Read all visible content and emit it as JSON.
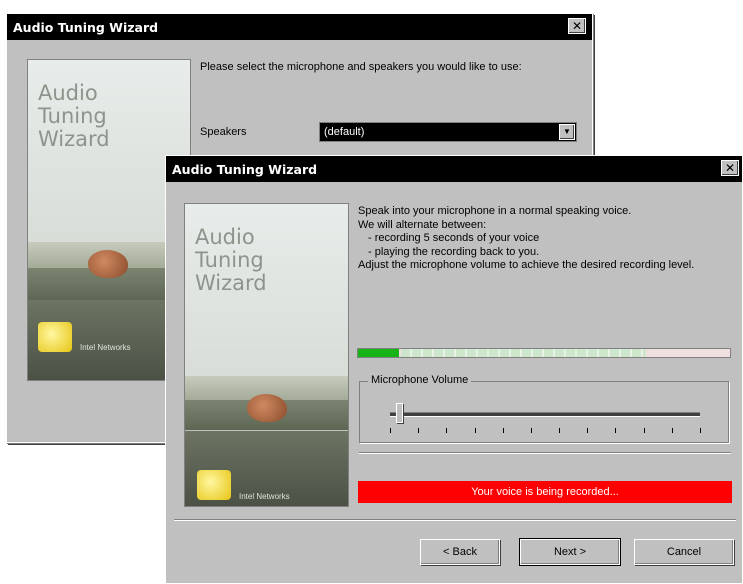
{
  "back_window": {
    "title": "Audio Tuning Wizard",
    "close_glyph": "✕",
    "instructions": "Please select the microphone and speakers you would like to use:",
    "speakers_label": "Speakers",
    "speakers_value": "(default)",
    "art": {
      "logo_text": "Audio\nTuning\nWizard",
      "brand": "Intel Networks"
    }
  },
  "front_window": {
    "title": "Audio Tuning Wizard",
    "close_glyph": "✕",
    "instructions": {
      "line1": "Speak into your microphone in a normal speaking voice.",
      "line2": "We will alternate between:",
      "bullet1": "- recording 5 seconds of your voice",
      "bullet2": "- playing the recording back to you.",
      "line3": "Adjust the microphone volume to achieve the desired recording level."
    },
    "level_meter_fraction": 0.11,
    "microphone_volume": {
      "label": "Microphone Volume",
      "value_fraction": 0.03
    },
    "status_text": "Your voice is being recorded...",
    "buttons": {
      "back": "< Back",
      "next": "Next >",
      "cancel": "Cancel"
    },
    "art": {
      "logo_text": "Audio\nTuning\nWizard",
      "brand": "Intel Networks"
    }
  },
  "colors": {
    "status_red": "#ff0000",
    "meter_green": "#16b416",
    "dialog_face": "#c0c0c0"
  }
}
